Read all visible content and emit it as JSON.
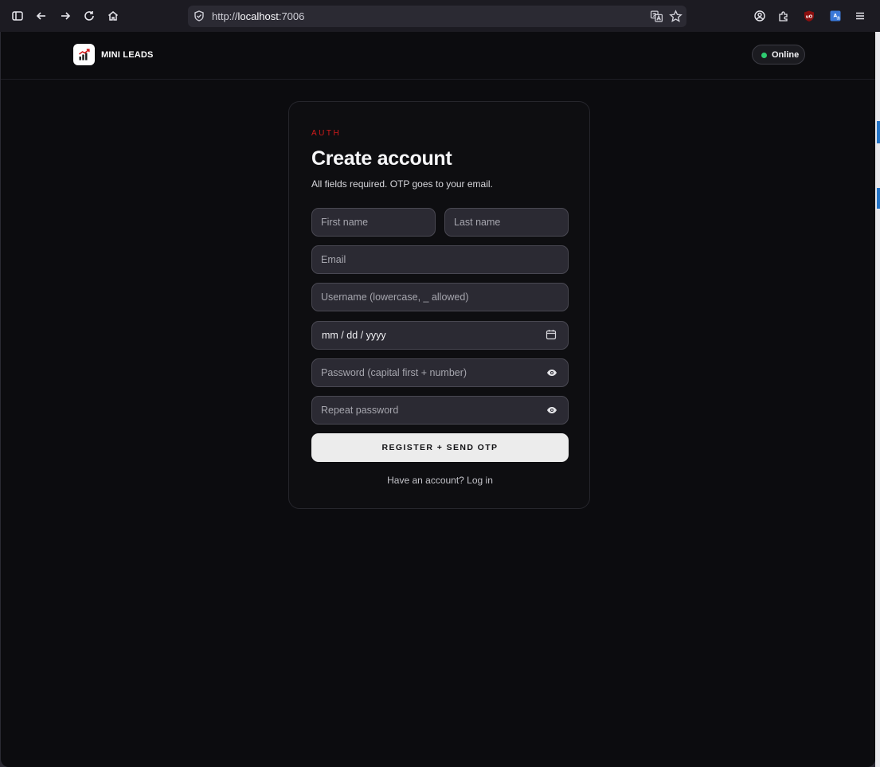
{
  "browser": {
    "url_scheme": "http://",
    "url_host": "localhost",
    "url_port": ":7006"
  },
  "header": {
    "brand": "MINI LEADS",
    "status": "Online",
    "status_color": "#2ecc71"
  },
  "auth": {
    "eyebrow": "AUTH",
    "title": "Create account",
    "subtitle": "All fields required. OTP goes to your email.",
    "fields": {
      "first_name": "First name",
      "last_name": "Last name",
      "email": "Email",
      "username": "Username (lowercase, _ allowed)",
      "dob": "mm / dd / yyyy",
      "password": "Password (capital first + number)",
      "repeat_password": "Repeat password"
    },
    "submit_label": "REGISTER + SEND OTP",
    "footer_link": "Have an account? Log in"
  },
  "colors": {
    "accent": "#d21b1b",
    "background": "#0c0c0f",
    "input_bg": "#2b2a33",
    "button_bg": "#ececec"
  }
}
